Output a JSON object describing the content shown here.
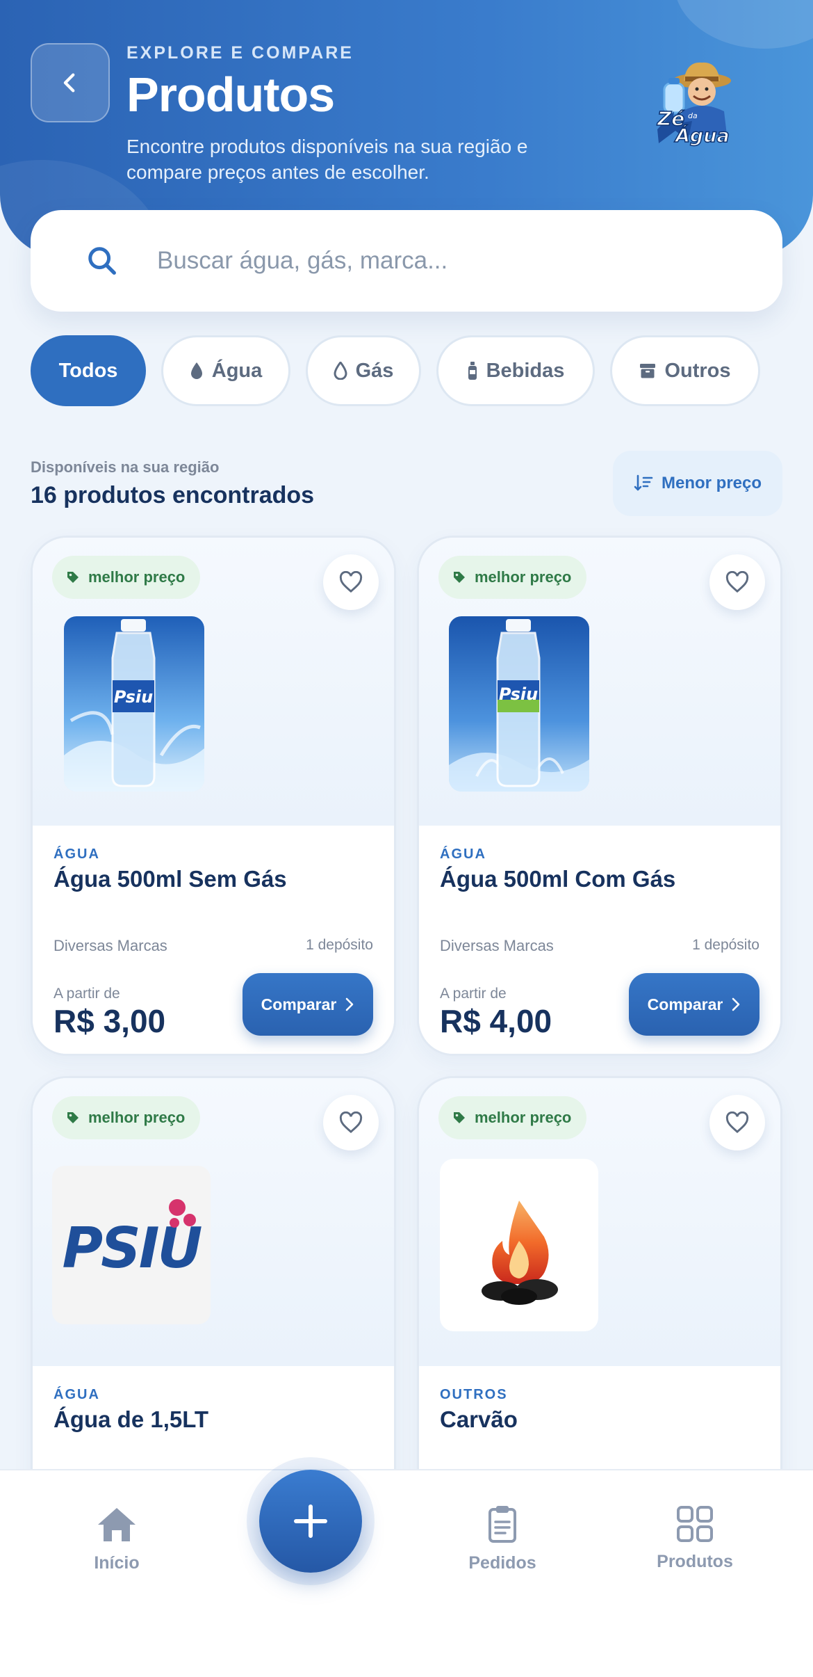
{
  "header": {
    "eyebrow": "EXPLORE E COMPARE",
    "title": "Produtos",
    "subtitle": "Encontre produtos disponíveis na sua região e compare preços antes de escolher.",
    "logo_text": "Zé da Água"
  },
  "search": {
    "placeholder": "Buscar água, gás, marca..."
  },
  "filters": [
    {
      "label": "Todos",
      "icon": "none",
      "active": true
    },
    {
      "label": "Água",
      "icon": "water-drop-icon",
      "active": false
    },
    {
      "label": "Gás",
      "icon": "flame-icon",
      "active": false
    },
    {
      "label": "Bebidas",
      "icon": "bottle-icon",
      "active": false
    },
    {
      "label": "Outros",
      "icon": "box-icon",
      "active": false
    }
  ],
  "results": {
    "availability": "Disponíveis na sua região",
    "count": "16 produtos encontrados",
    "sort_label": "Menor preço"
  },
  "products": [
    {
      "badge": "melhor preço",
      "category": "ÁGUA",
      "name": "Água 500ml Sem Gás",
      "brand": "Diversas Marcas",
      "depots": "1 depósito",
      "from_label": "A partir de",
      "price": "R$ 3,00",
      "cta": "Comparar",
      "image_brand": "Psiu"
    },
    {
      "badge": "melhor preço",
      "category": "ÁGUA",
      "name": "Água 500ml Com Gás",
      "brand": "Diversas Marcas",
      "depots": "1 depósito",
      "from_label": "A partir de",
      "price": "R$ 4,00",
      "cta": "Comparar",
      "image_brand": "Psiu"
    },
    {
      "badge": "melhor preço",
      "category": "ÁGUA",
      "name": "Água de 1,5LT",
      "image_brand": "PSIU"
    },
    {
      "badge": "melhor preço",
      "category": "OUTROS",
      "name": "Carvão"
    }
  ],
  "nav": {
    "items": [
      {
        "label": "Início",
        "icon": "home-icon"
      },
      {
        "label": "Pedidos",
        "icon": "clipboard-icon"
      },
      {
        "label": "Produtos",
        "icon": "grid-icon"
      }
    ],
    "fab_icon": "plus-icon"
  },
  "colors": {
    "primary": "#2f6fc0",
    "header_gradient_start": "#2b63b4",
    "header_gradient_end": "#4a95da",
    "badge_bg": "#e6f5ea",
    "badge_text": "#2f7a47",
    "text_dark": "#17325e",
    "text_muted": "#7d8798"
  }
}
